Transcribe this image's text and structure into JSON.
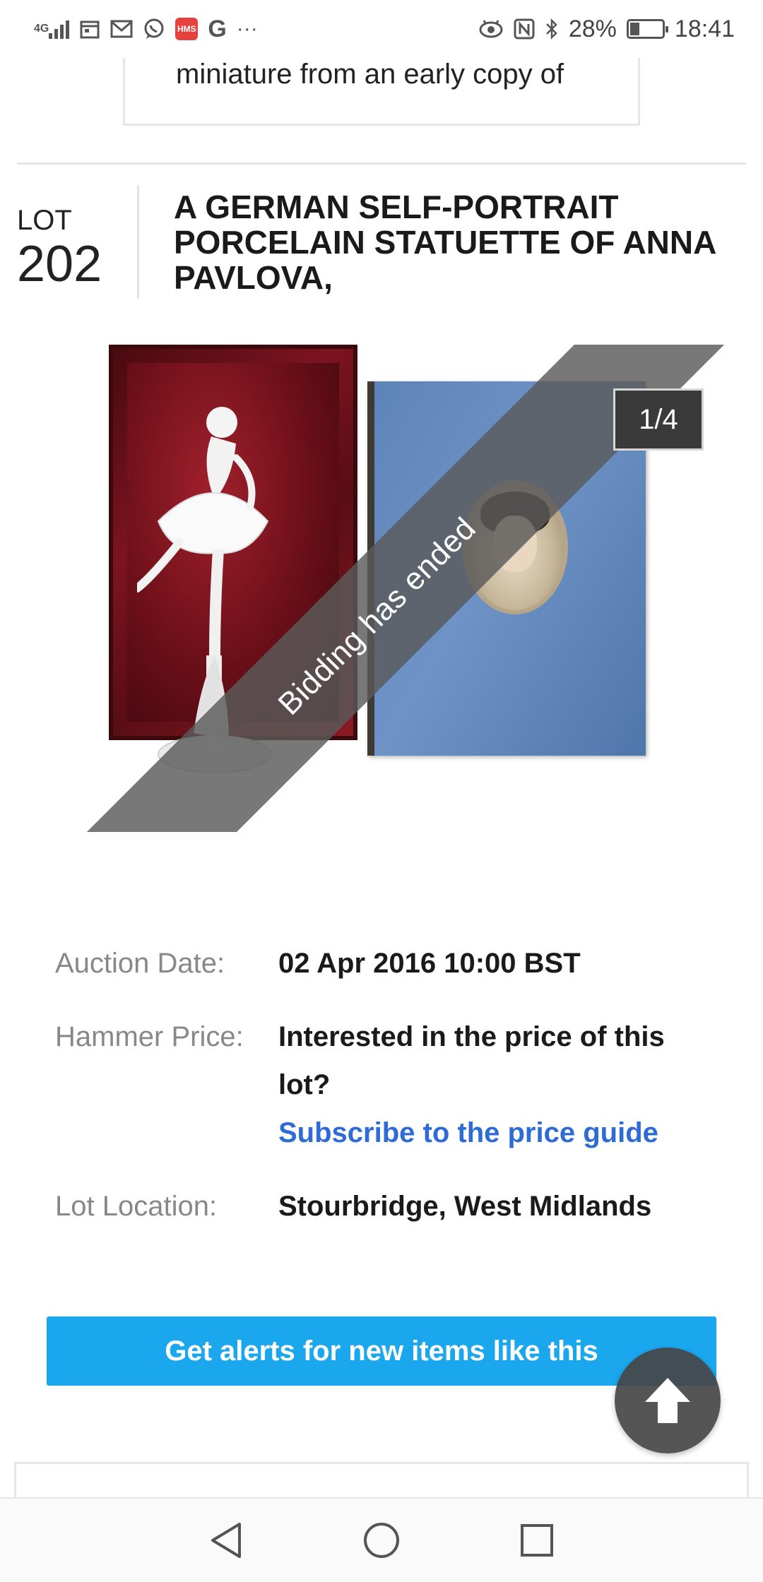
{
  "status_bar": {
    "network": "4G",
    "battery_percent": "28%",
    "time": "18:41",
    "left_icons": [
      "signal-icon",
      "calendar-icon",
      "gmail-icon",
      "whatsapp-icon",
      "hms-icon",
      "google-icon",
      "more-icon"
    ],
    "right_icons": [
      "eye-icon",
      "nfc-icon",
      "bluetooth-icon",
      "battery-icon"
    ],
    "hms_label": "HMS",
    "google_label": "G",
    "more_label": "···"
  },
  "previous_card": {
    "text": "miniature from an early copy of"
  },
  "lot": {
    "label": "LOT",
    "number": "202",
    "title": "A GERMAN SELF-PORTRAIT PORCELAIN STATUETTE OF ANNA PAVLOVA,"
  },
  "gallery": {
    "banner": "Bidding has ended",
    "counter": "1/4"
  },
  "details": {
    "auction_date_label": "Auction Date:",
    "auction_date_value": "02 Apr 2016 10:00 BST",
    "hammer_price_label": "Hammer Price:",
    "hammer_price_value": "Interested in the price of this lot?",
    "hammer_price_link": "Subscribe to the price guide",
    "lot_location_label": "Lot Location:",
    "lot_location_value": "Stourbridge, West Midlands"
  },
  "cta": {
    "label": "Get alerts for new items like this"
  },
  "colors": {
    "cta": "#1aa7ee",
    "link": "#2e6bd6",
    "banner": "#5a5a5a"
  }
}
